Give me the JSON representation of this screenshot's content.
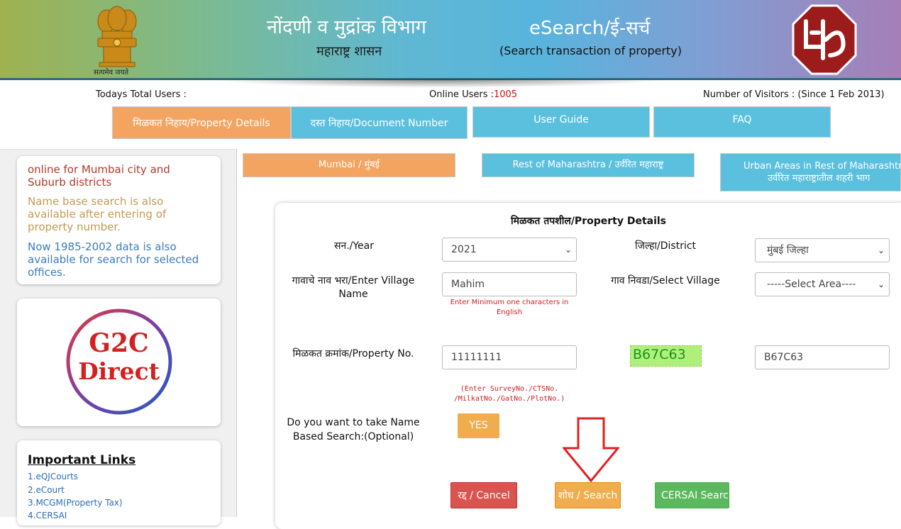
{
  "header": {
    "dept_title": "नोंदणी व मुद्रांक विभाग",
    "gov_subtitle": "महाराष्ट्र शासन",
    "app_title": "eSearch/ई-सर्च",
    "app_subtitle": "(Search transaction of property)",
    "emblem_caption": "सत्यमेव जयते",
    "colors": {
      "gradient_start": "#9fb24f",
      "gradient_end": "#a57fb7"
    }
  },
  "stats": {
    "todays_users_label": "Todays Total Users :",
    "online_users_label": "Online Users :",
    "online_users_value": "1005",
    "visitors_label": "Number of Visitors : (Since 1 Feb 2013)"
  },
  "top_tabs": [
    {
      "label": "मिळकत निहाय/Property Details",
      "active": true
    },
    {
      "label": "दस्त निहाय/Document Number",
      "active": false
    },
    {
      "label": "User Guide",
      "active": false
    },
    {
      "label": "FAQ",
      "active": false
    }
  ],
  "sidebar": {
    "news": [
      "online for Mumbai city and Suburb districts",
      "Name base search is also available after entering of property number.",
      "Now 1985-2002 data is also available for search for selected offices."
    ],
    "g2c_line1": "G2C",
    "g2c_line2": "Direct",
    "links_title": "Important Links",
    "links": [
      "1.eQJCourts",
      "2.eCourt",
      "3.MCGM(Property Tax)",
      "4.CERSAI"
    ]
  },
  "region_tabs": [
    {
      "label": "Mumbai / मुंबई",
      "active": true
    },
    {
      "label": "Rest of Maharashtra / उर्वरित महाराष्ट्र",
      "active": false
    },
    {
      "label_line1": "Urban Areas in Rest of Maharashtra",
      "label_line2": "उर्वरित महाराष्ट्रातील शहरी भाग",
      "active": false
    }
  ],
  "form": {
    "title": "मिळकत तपशील/Property Details",
    "year_label": "सन./Year",
    "year_value": "2021",
    "district_label": "जिल्हा/District",
    "district_value": "मुंबई जिल्हा",
    "village_label_line1": "गावाचे नाव भरा/Enter Village",
    "village_label_line2": "Name",
    "village_value": "Mahim",
    "village_hint_line1": "Enter Minimum one characters in",
    "village_hint_line2": "English",
    "select_village_label": "गाव निवडा/Select Village",
    "select_village_value": "-----Select Area----",
    "property_label": "मिळकत क्रमांक/Property No.",
    "property_value": "11111111",
    "property_hint_line1": "(Enter SurveyNo./CTSNo.",
    "property_hint_line2": "/MilkatNo./GatNo./PlotNo.)",
    "captcha_text": "B67C63",
    "captcha_input_value": "B67C63",
    "name_search_label_line1": "Do you want to take Name",
    "name_search_label_line2": "Based Search:(Optional)",
    "yes_button": "YES",
    "cancel_button": "रद्द / Cancel",
    "search_button": "शोध / Search",
    "cersai_button": "CERSAI Search"
  }
}
